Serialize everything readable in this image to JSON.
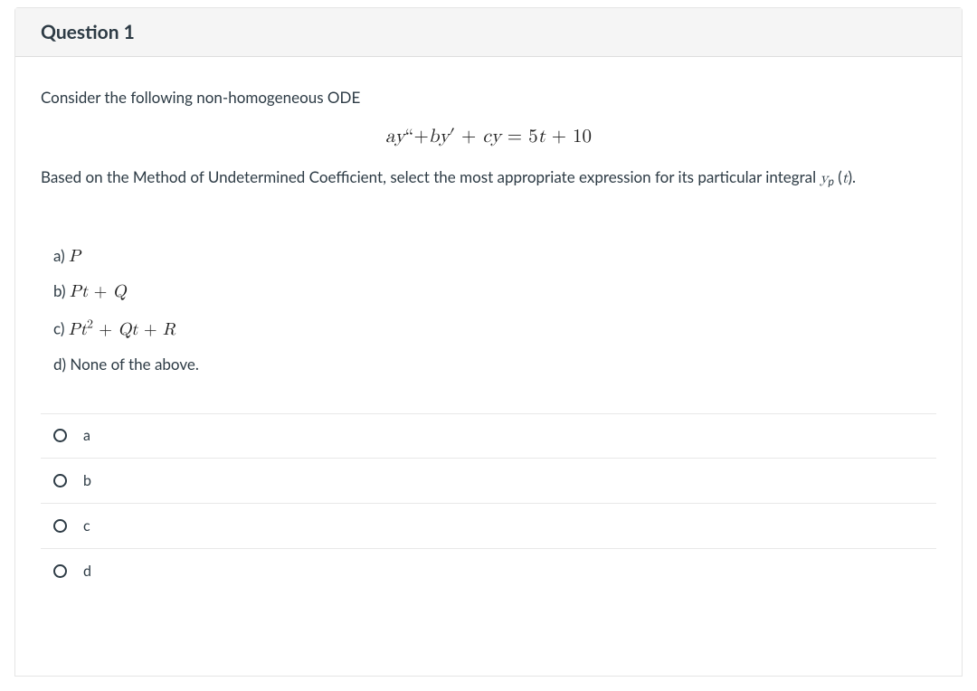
{
  "header": {
    "title": "Question 1"
  },
  "prompt": {
    "line1": "Consider the following non-homogeneous ODE",
    "equation_html": "<span class='mi'>ay</span>“+<span class='mi'>by</span>′ + <span class='mi'>cy</span> = 5<span class='mi'>t</span> + 10",
    "line2_html": "Based on the Method of Undetermined Coefficient, select the most appropriate expression for its particular integral <span class='mi'>y</span><span class='sub'>p</span> (<span class='mi'>t</span>)."
  },
  "choices": [
    {
      "label": "a) ",
      "expr_html": "<span class='mi'>P</span>"
    },
    {
      "label": "b) ",
      "expr_html": "<span class='mi'>Pt</span> + <span class='mi'>Q</span>"
    },
    {
      "label": "c) ",
      "expr_html": "<span class='mi'>Pt</span><span class='sup'>2</span> + <span class='mi'>Qt</span> + <span class='mi'>R</span>"
    },
    {
      "label": "d) ",
      "expr_html": "",
      "plain": "None of the above."
    }
  ],
  "answers": [
    {
      "id": "a",
      "label": "a"
    },
    {
      "id": "b",
      "label": "b"
    },
    {
      "id": "c",
      "label": "c"
    },
    {
      "id": "d",
      "label": "d"
    }
  ]
}
